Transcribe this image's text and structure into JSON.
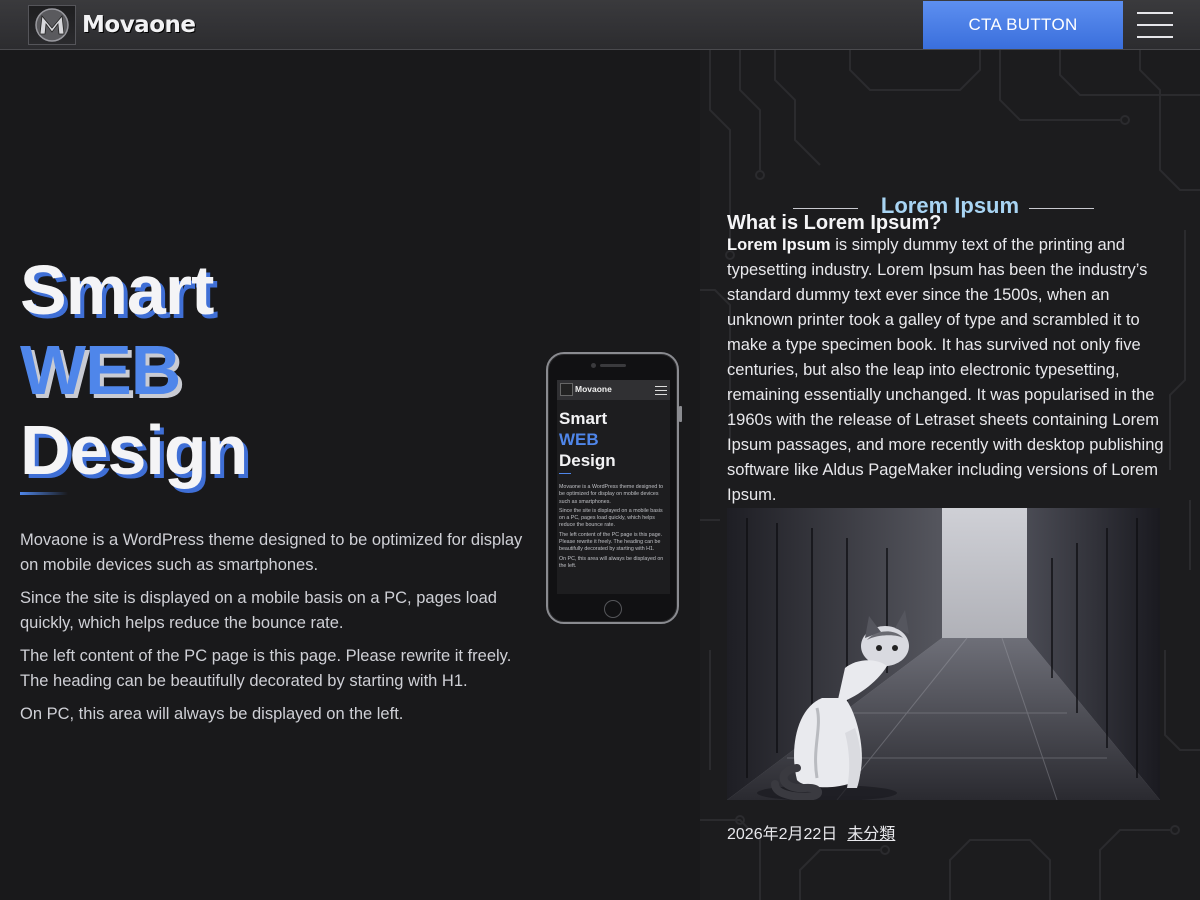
{
  "header": {
    "brand": "Movaone",
    "logo_icon": "m-emblem-icon",
    "cta_label": "CTA BUTTON",
    "menu_icon": "hamburger-menu-icon"
  },
  "hero": {
    "title_line1": "Smart",
    "title_line2": "WEB",
    "title_line3": "Design",
    "paragraphs": [
      "Movaone is a WordPress theme designed to be optimized for display on mobile devices such as smartphones.",
      "Since the site is displayed on a mobile basis on a PC, pages load quickly, which helps reduce the bounce rate.",
      "The left content of the PC page is this page. Please rewrite it freely. The heading can be beautifully decorated by starting with H1.",
      "On PC, this area will always be displayed on the left."
    ]
  },
  "phone_preview": {
    "brand": "Movaone",
    "title_line1": "Smart",
    "title_line2": "WEB",
    "title_line3": "Design",
    "paragraphs": [
      "Movaone is a WordPress theme designed to be optimized for display on mobile devices such as smartphones.",
      "Since the site is displayed on a mobile basis on a PC, pages load quickly, which helps reduce the bounce rate.",
      "The left content of the PC page is this page. Please rewrite it freely. The heading can be beautifully decorated by starting with H1.",
      "On PC, this area will always be displayed on the left."
    ]
  },
  "article": {
    "section_title": "Lorem Ipsum",
    "heading": "What is Lorem Ipsum?",
    "lead_bold": "Lorem Ipsum",
    "body": " is simply dummy text of the printing and typesetting industry. Lorem Ipsum has been the industry’s standard dummy text ever since the 1500s, when an unknown printer took a galley of type and scrambled it to make a type specimen book. It has survived not only five centuries, but also the leap into electronic typesetting, remaining essentially unchanged. It was popularised in the 1960s with the release of Letraset sheets containing Lorem Ipsum passages, and more recently with desktop publishing software like Aldus PageMaker including versions of Lorem Ipsum.",
    "date": "2026年2月22日",
    "category": "未分類"
  },
  "colors": {
    "accent_blue": "#4f86ea",
    "cta_blue": "#3a6fdc",
    "section_title": "#a8d4f3",
    "background": "#19191b"
  }
}
